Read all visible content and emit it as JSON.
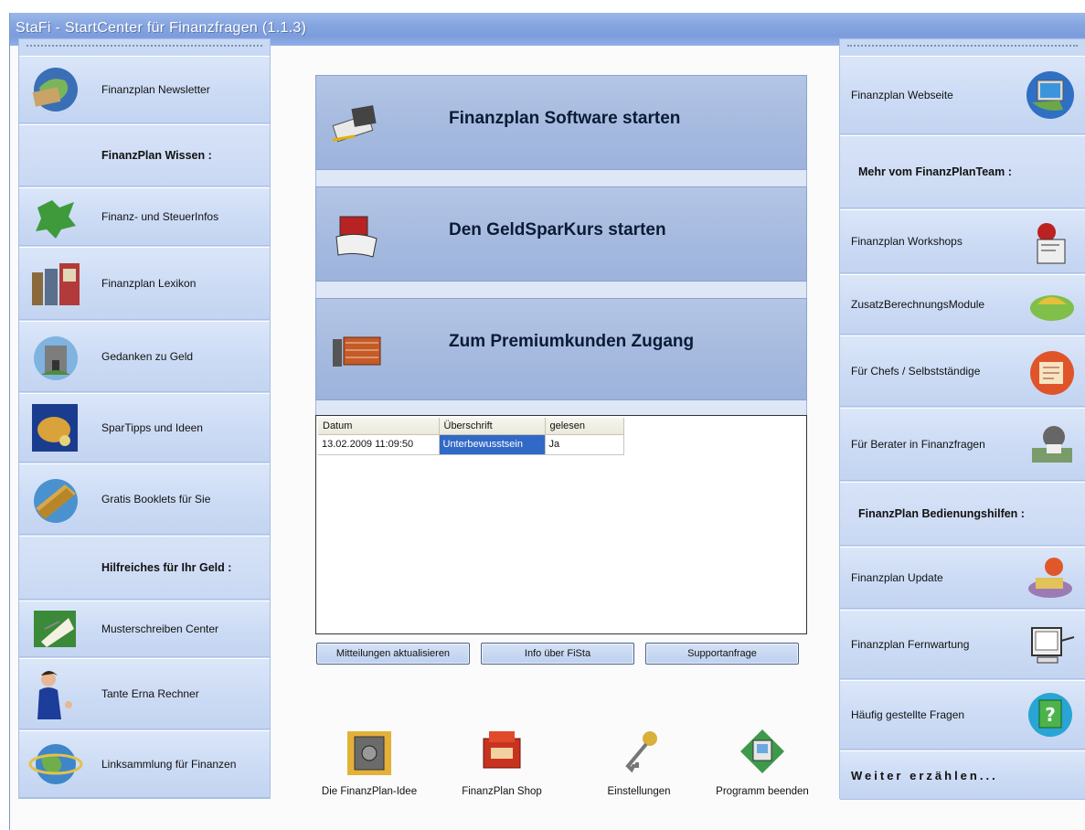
{
  "window": {
    "title": "StaFi - StartCenter für Finanzfragen (1.1.3)"
  },
  "left_panel": {
    "newsletter": "Finanzplan Newsletter",
    "header_wissen": "FinanzPlan Wissen :",
    "steuerinfos": "Finanz- und SteuerInfos",
    "lexikon": "Finanzplan Lexikon",
    "gedanken": "Gedanken zu Geld",
    "spartipps": "SparTipps und Ideen",
    "booklets": "Gratis Booklets für Sie",
    "header_hilfreiches": "Hilfreiches für Ihr Geld :",
    "musterschreiben": "Musterschreiben Center",
    "tante_erna": "Tante Erna Rechner",
    "linksammlung": "Linksammlung für Finanzen"
  },
  "right_panel": {
    "webseite": "Finanzplan Webseite",
    "header_mehr": "Mehr vom FinanzPlanTeam :",
    "workshops": "Finanzplan Workshops",
    "zusatz": "ZusatzBerechnungsModule",
    "chefs": "Für Chefs / Selbstständige",
    "berater": "Für Berater in Finanzfragen",
    "header_hilfen": "FinanzPlan Bedienungshilfen :",
    "update": "Finanzplan Update",
    "fernwartung": "Finanzplan Fernwartung",
    "faq": "Häufig gestellte Fragen",
    "weiter": "Weiter erzählen..."
  },
  "center": {
    "btn_software": "Finanzplan Software starten",
    "btn_geldsparkurs": "Den GeldSparKurs starten",
    "btn_premium": "Zum Premiumkunden Zugang"
  },
  "messages": {
    "columns": [
      "Datum",
      "Überschrift",
      "gelesen"
    ],
    "rows": [
      {
        "datum": "13.02.2009 11:09:50",
        "ueberschrift": "Unterbewusstsein",
        "gelesen": "Ja"
      }
    ]
  },
  "actions": {
    "refresh": "Mitteilungen aktualisieren",
    "info": "Info über FiSta",
    "support": "Supportanfrage"
  },
  "bottom_tools": {
    "idee": "Die FinanzPlan-Idee",
    "shop": "FinanzPlan Shop",
    "einstellungen": "Einstellungen",
    "beenden": "Programm beenden"
  }
}
